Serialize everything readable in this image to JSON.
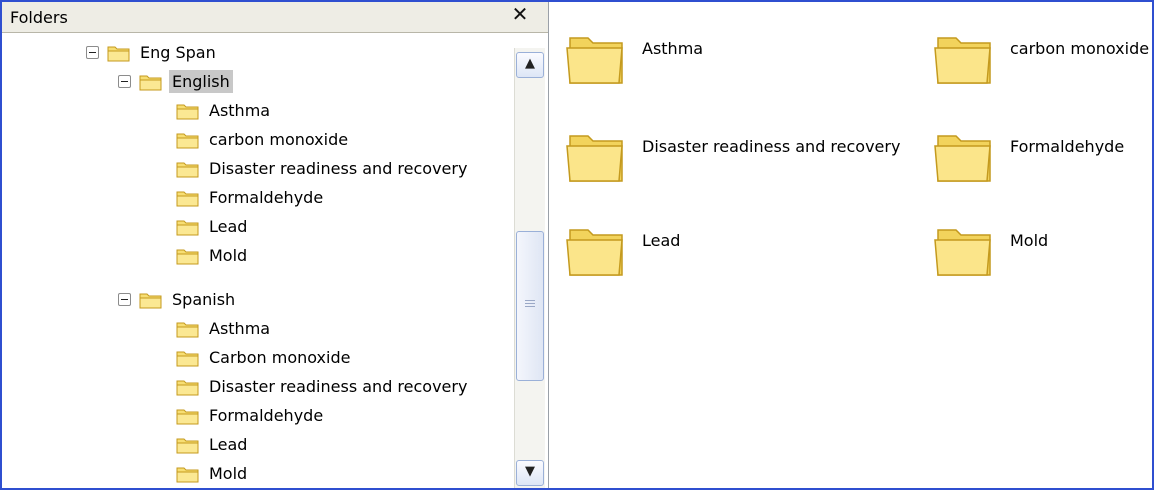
{
  "left_pane": {
    "title": "Folders",
    "close_glyph": "✕",
    "scroll_up_glyph": "▲",
    "scroll_down_glyph": "▼",
    "tree": {
      "root": "Eng Span",
      "english": {
        "label": "English",
        "children": [
          "Asthma",
          "carbon monoxide",
          "Disaster readiness and recovery",
          "Formaldehyde",
          "Lead",
          "Mold"
        ]
      },
      "spanish": {
        "label": "Spanish",
        "children": [
          "Asthma",
          "Carbon monoxide",
          "Disaster readiness and recovery",
          "Formaldehyde",
          "Lead",
          "Mold"
        ]
      }
    }
  },
  "right_pane": {
    "items": [
      "Asthma",
      "carbon monoxide",
      "Disaster readiness and recovery",
      "Formaldehyde",
      "Lead",
      "Mold"
    ]
  },
  "colors": {
    "window_border": "#2f4fd0",
    "folder_fill": "#f7de73",
    "folder_stroke": "#c49a1e",
    "selection": "#c8c8c8"
  },
  "icons": {
    "folder": "folder-icon",
    "collapse": "minus-box-icon",
    "close": "close-icon"
  }
}
